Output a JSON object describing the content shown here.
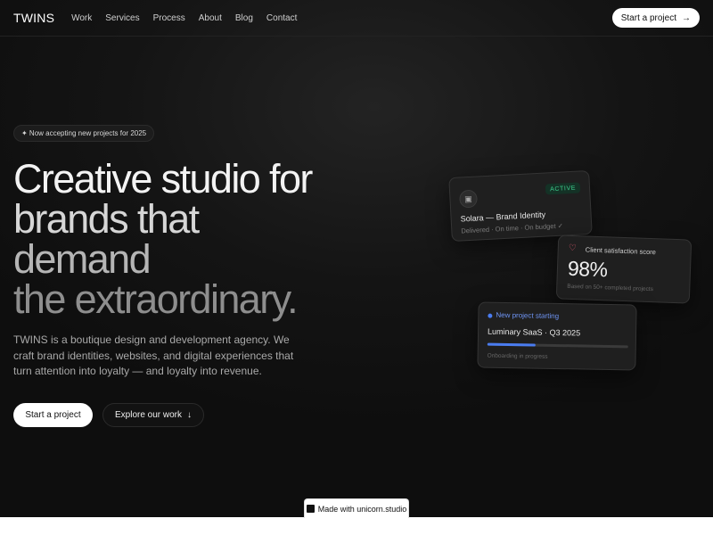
{
  "nav": {
    "logo": "TWINS",
    "links": [
      "Work",
      "Services",
      "Process",
      "About",
      "Blog",
      "Contact"
    ],
    "cta_label": "Start a project",
    "cta_icon": "arrow-right-icon"
  },
  "hero": {
    "badge": "✦ Now accepting new projects for 2025",
    "title_lines": [
      "Creative studio for",
      "brands that",
      "demand",
      "the extraordinary."
    ],
    "description": "TWINS is a boutique design and development agency. We craft brand identities, websites, and digital experiences that turn attention into loyalty — and loyalty into revenue.",
    "primary_label": "Start a project",
    "secondary_label": "Explore our work",
    "secondary_icon": "arrow-down-icon"
  },
  "cards": {
    "project": {
      "status": "ACTIVE",
      "title": "Solara — Brand Identity",
      "subtitle": "Delivered · On time · On budget ✓",
      "icon": "image-icon"
    },
    "satisfaction": {
      "label": "Client satisfaction score",
      "value": "98%",
      "subtitle": "Based on 50+ completed projects",
      "icon": "heart-icon"
    },
    "new_project": {
      "label": "New project starting",
      "title": "Luminary SaaS · Q3 2025",
      "progress": 0.34,
      "subtitle": "Onboarding in progress"
    }
  },
  "footer_badge": {
    "label": "Made with unicorn.studio"
  },
  "colors": {
    "background": "#0e0e0e",
    "accent_blue": "#4a7cf0",
    "active_green": "#3ecf8e",
    "heart_red": "#e05a6f"
  }
}
